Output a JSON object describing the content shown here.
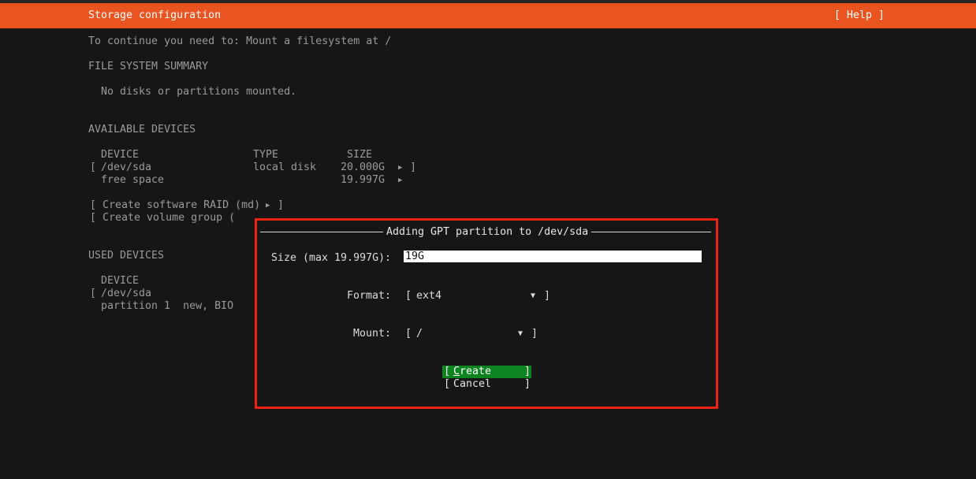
{
  "header": {
    "title": "Storage configuration",
    "help_label": "[ Help ]",
    "accent_color": "#e95420"
  },
  "main": {
    "notice": "To continue you need to: Mount a filesystem at /",
    "fs_summary_heading": "FILE SYSTEM SUMMARY",
    "fs_summary_empty": "No disks or partitions mounted.",
    "available_heading": "AVAILABLE DEVICES",
    "available_columns": {
      "device": "DEVICE",
      "type": "TYPE",
      "size": "SIZE"
    },
    "available_rows": [
      {
        "open": "[",
        "device": "/dev/sda",
        "type": "local disk",
        "size": "20.000G",
        "close": "]"
      },
      {
        "open": "",
        "device": "free space",
        "type": "",
        "size": "19.997G",
        "close": ""
      }
    ],
    "raid_action": "[ Create software RAID (md)",
    "raid_close": "]",
    "volume_group_action": "[ Create volume group (",
    "used_heading": "USED DEVICES",
    "used_column_device": "DEVICE",
    "used_rows": [
      {
        "open": "[",
        "device": "/dev/sda"
      },
      {
        "open": "",
        "device": "partition 1  new, BIO"
      }
    ]
  },
  "dialog": {
    "title": "Adding GPT partition to /dev/sda",
    "size_label": "Size (max 19.997G):",
    "size_value": "19G",
    "format_label": "Format:",
    "format_value": "ext4",
    "mount_label": "Mount:",
    "mount_value": "/",
    "create_first_letter": "C",
    "create_rest": "reate",
    "cancel_label": "Cancel",
    "highlight_color": "#ee2211",
    "button_focus_color": "#0e8420"
  },
  "icons": {
    "expand": "▶",
    "dropdown": "▼"
  }
}
